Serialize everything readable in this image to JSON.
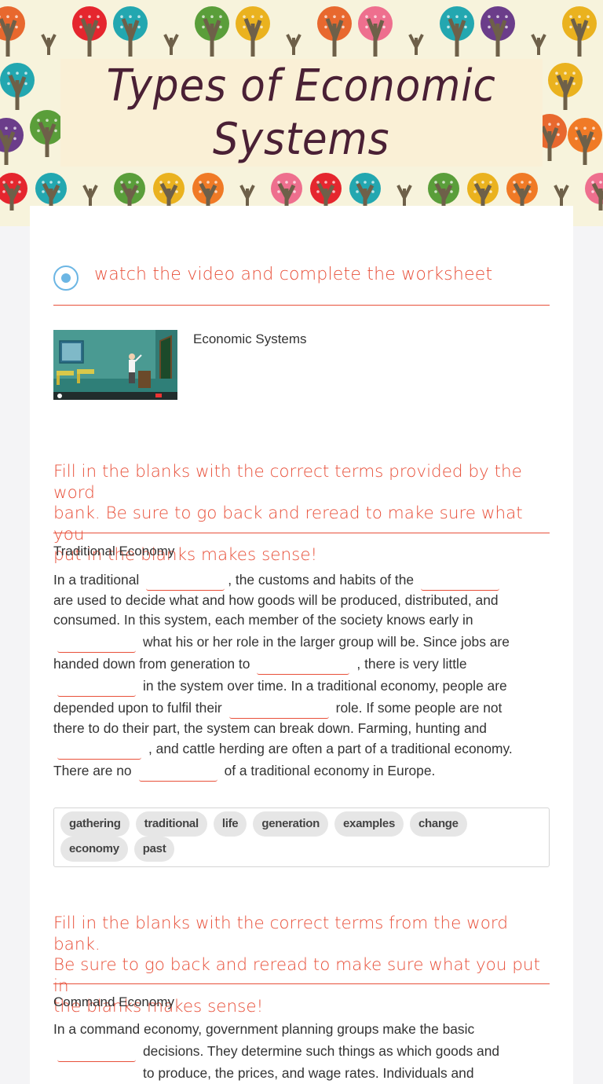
{
  "header": {
    "title_line1": "Types of Economic",
    "title_line2": "Systems"
  },
  "instruction": {
    "text": "watch the video and complete the worksheet",
    "icon": "radio-selected-icon"
  },
  "video": {
    "title": "Economic Systems",
    "thumbnail": "classroom-teacher-video-thumbnail"
  },
  "section1": {
    "instructions": "Fill in the blanks with the correct terms provided by the word bank. Be sure to go back and reread to make sure what you put in the blanks makes sense!",
    "instructions_lines": [
      "Fill in the blanks with the correct terms provided by the word",
      "bank. Be sure to go back and reread to make sure what you",
      "put in the blanks makes sense!"
    ],
    "label": "Traditional Economy",
    "lines": [
      [
        "In a traditional",
        ", the customs and habits of the",
        ""
      ],
      [
        "are used to decide what and how goods will be produced, distributed, and"
      ],
      [
        "consumed. In this system, each member of the society knows early in"
      ],
      [
        "",
        "what his or her role in the larger group will be. Since jobs are"
      ],
      [
        "handed down from generation to",
        ", there is very little"
      ],
      [
        "",
        "in the system over time. In a traditional economy, people are"
      ],
      [
        "depended upon to fulfil their",
        "role. If some people are not"
      ],
      [
        "there to do their part, the system can break down. Farming, hunting and"
      ],
      [
        "",
        ", and cattle herding are often a part of a traditional economy."
      ],
      [
        "There are no",
        "of a traditional economy in Europe."
      ]
    ],
    "word_bank": [
      "gathering",
      "traditional",
      "life",
      "generation",
      "examples",
      "change",
      "economy",
      "past"
    ]
  },
  "section2": {
    "instructions_lines": [
      "Fill in the blanks with the correct terms from the word bank.",
      "Be sure to go back and reread to make sure what you put in",
      "the blanks makes sense!"
    ],
    "label": "Command Economy",
    "lines": [
      [
        "In a command economy, government planning groups make the basic"
      ],
      [
        "decisions. They determine such things as which goods and"
      ],
      [
        "to produce, the prices, and wage rates. Individuals and"
      ]
    ]
  }
}
